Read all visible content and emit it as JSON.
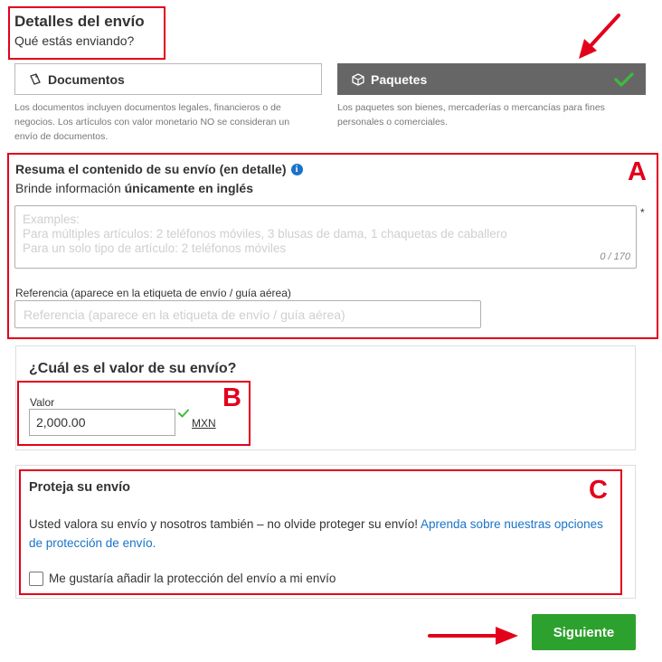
{
  "header": {
    "title": "Detalles del envío",
    "subtitle": "Qué estás enviando?"
  },
  "shipment_type": {
    "documents": {
      "label": "Documentos",
      "description": "Los documentos incluyen documentos legales, financieros o de negocios. Los artículos con valor monetario NO se consideran un envío de documentos.",
      "selected": false,
      "icon": "document-icon"
    },
    "packages": {
      "label": "Paquetes",
      "description": "Los paquetes son bienes, mercaderías o mercancías para fines personales o comerciales.",
      "selected": true,
      "icon": "package-icon"
    }
  },
  "contents": {
    "title": "Resuma el contenido de su envío (en detalle)",
    "subtitle_prefix": "Brinde información ",
    "subtitle_bold": "únicamente en inglés",
    "placeholder_lines": [
      "Examples:",
      "Para múltiples artículos: 2 teléfonos móviles, 3 blusas de dama, 1 chaquetas de caballero",
      "Para un solo tipo de artículo: 2 teléfonos móviles"
    ],
    "counter": "0 / 170",
    "required_marker": "*",
    "reference_label": "Referencia (aparece en la etiqueta de envío / guía aérea)",
    "reference_placeholder": "Referencia (aparece en la etiqueta de envío / guía aérea)"
  },
  "value": {
    "title": "¿Cuál es el valor de su envío?",
    "label": "Valor",
    "amount": "2,000.00",
    "currency": "MXN"
  },
  "protection": {
    "title": "Proteja su envío",
    "text": "Usted valora su envío y nosotros también – no olvide proteger su envío! ",
    "link": "Aprenda sobre nuestras opciones de protección de envío.",
    "checkbox_label": "Me gustaría añadir la protección del envío a mi envío",
    "checked": false
  },
  "actions": {
    "next_label": "Siguiente"
  },
  "annotations": {
    "label_a": "A",
    "label_b": "B",
    "label_c": "C"
  },
  "colors": {
    "annotation_red": "#e3001b",
    "primary_green": "#2da12d",
    "selected_gray": "#666666",
    "link_blue": "#1a73c8"
  }
}
